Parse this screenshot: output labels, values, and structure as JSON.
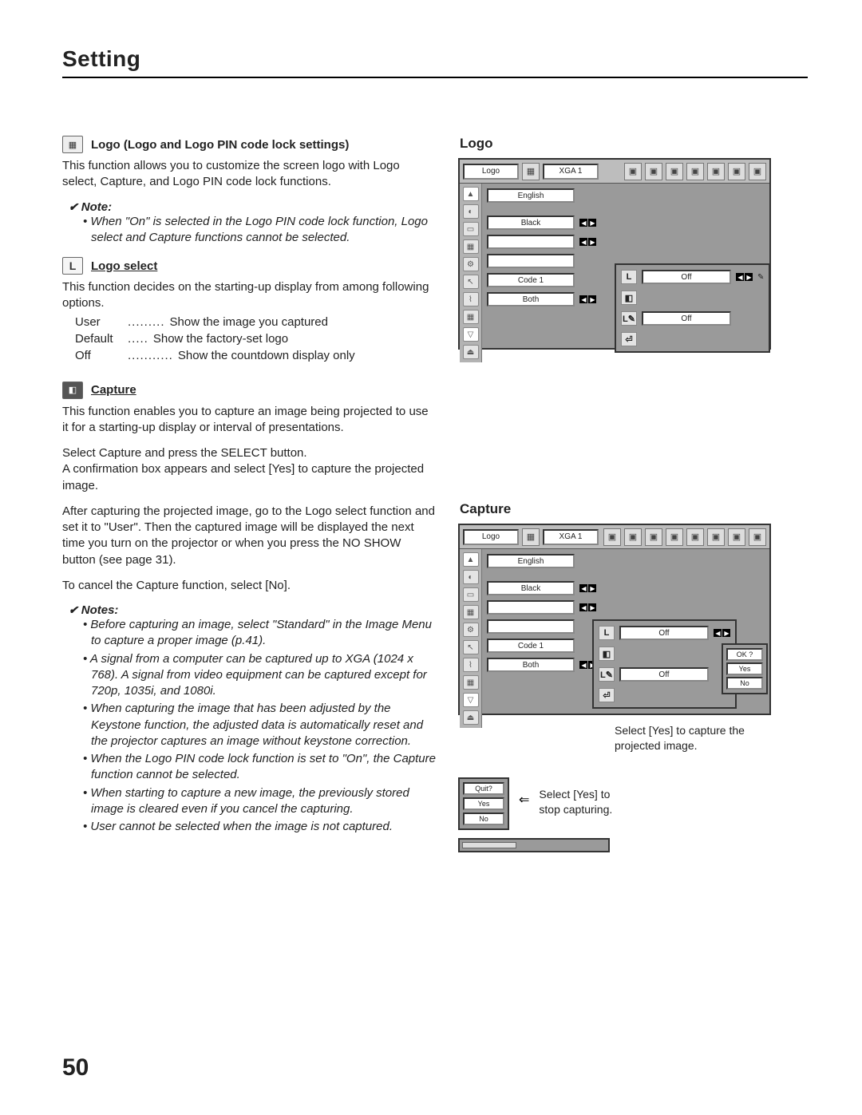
{
  "header": "Setting",
  "page_number": "50",
  "left": {
    "logo_section": {
      "title": "Logo (Logo and Logo PIN code lock settings)",
      "body": "This function allows you to customize the screen logo with Logo select, Capture, and Logo PIN code lock functions.",
      "note_label": "Note:",
      "note1": "When \"On\" is selected in the Logo PIN code lock function, Logo select and Capture functions cannot be selected."
    },
    "logo_select": {
      "title": "Logo select",
      "body": "This function decides on the starting-up display from among following options.",
      "defs": [
        {
          "k": "User",
          "v": "Show the image you captured"
        },
        {
          "k": "Default",
          "v": "Show the factory-set logo"
        },
        {
          "k": "Off",
          "v": "Show the countdown display only"
        }
      ]
    },
    "capture": {
      "title": "Capture",
      "p1": "This function enables you to capture an image being projected to use it for a starting-up display or interval of presentations.",
      "p2a": "Select Capture and press the SELECT button.",
      "p2b": "A confirmation box appears and select [Yes] to capture the projected image.",
      "p3": "After capturing the projected image, go to the Logo select function and set it to \"User\". Then the captured image will be displayed the next time you turn on the projector or when you press the NO SHOW button (see page 31).",
      "p4": "To cancel the Capture function, select [No].",
      "notes_label": "Notes:",
      "notes": [
        "Before capturing an image, select \"Standard\" in the Image Menu to capture a proper image (p.41).",
        "A signal from a computer can be captured up to XGA (1024 x 768). A signal from video equipment can be captured except for 720p, 1035i, and 1080i.",
        "When capturing the image that has been adjusted by the Keystone function, the adjusted data is automatically reset and the projector captures an image without keystone correction.",
        "When the Logo PIN code lock function is set to \"On\", the Capture function cannot be selected.",
        "When starting to capture a new image, the previously stored image is cleared even if you cancel the capturing.",
        "User cannot be selected when the image is not captured."
      ]
    }
  },
  "right": {
    "logo_heading": "Logo",
    "capture_heading": "Capture",
    "osd": {
      "top_title": "Logo",
      "top_mode": "XGA 1",
      "rows": {
        "english": "English",
        "black": "Black",
        "blank1": "",
        "blank2": "",
        "code1": "Code 1",
        "both": "Both"
      },
      "sub_off1": "Off",
      "sub_off2": "Off"
    },
    "confirm": {
      "ok": "OK ?",
      "yes": "Yes",
      "no": "No"
    },
    "caption1": "Select [Yes] to capture the projected image.",
    "quit": {
      "quit": "Quit?",
      "yes": "Yes",
      "no": "No"
    },
    "caption2a": "Select [Yes] to",
    "caption2b": "stop capturing."
  }
}
